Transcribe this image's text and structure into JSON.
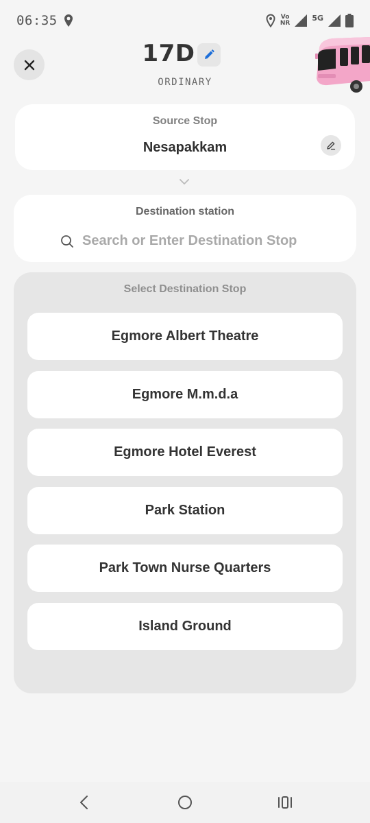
{
  "status_bar": {
    "time": "06:35",
    "volte_top": "Vo",
    "volte_bottom": "NR",
    "network": "5G"
  },
  "header": {
    "route_number": "17D",
    "route_type": "ORDINARY",
    "close_icon": "close-icon",
    "edit_icon": "pencil-icon"
  },
  "source": {
    "label": "Source Stop",
    "name": "Nesapakkam"
  },
  "destination": {
    "label": "Destination station",
    "placeholder": "Search or Enter Destination Stop",
    "value": ""
  },
  "stops_panel": {
    "title": "Select Destination Stop",
    "items": [
      {
        "label": "Egmore Albert Theatre"
      },
      {
        "label": "Egmore M.m.d.a"
      },
      {
        "label": "Egmore Hotel Everest"
      },
      {
        "label": "Park Station"
      },
      {
        "label": "Park Town Nurse Quarters"
      },
      {
        "label": "Island Ground"
      }
    ]
  },
  "colors": {
    "background": "#f5f5f5",
    "card": "#ffffff",
    "panel": "#e6e6e6",
    "accent_blue": "#1e6fd9",
    "bus_pink": "#f3a6c8"
  }
}
